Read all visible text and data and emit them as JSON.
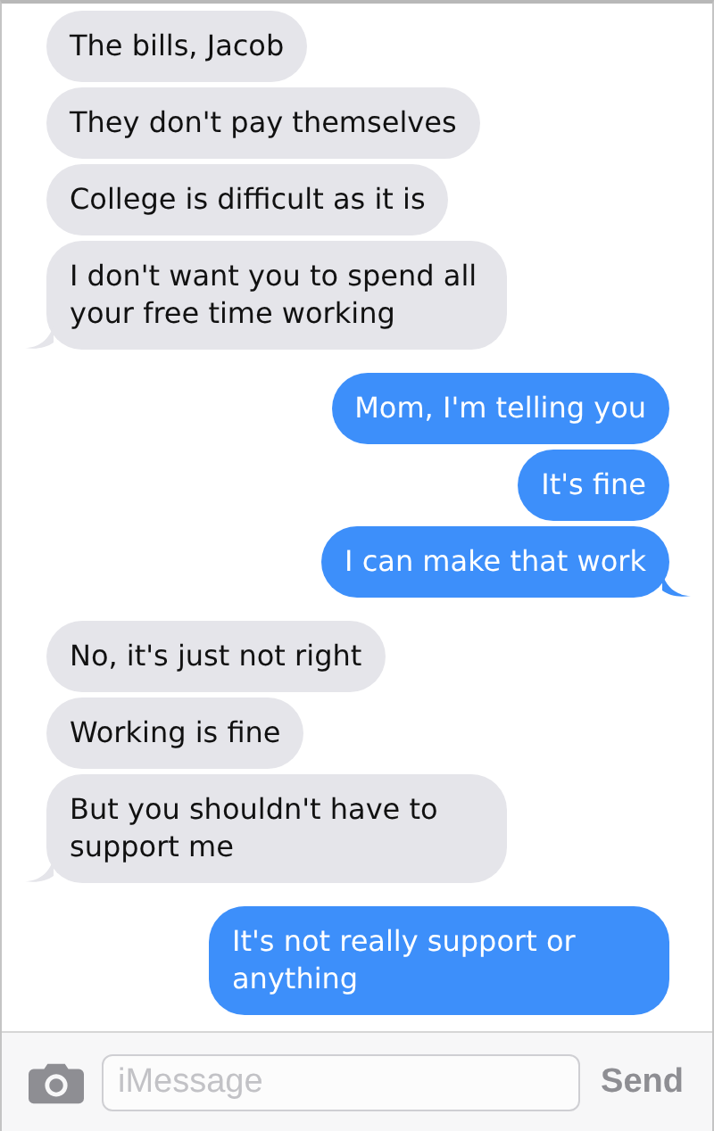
{
  "messages": [
    {
      "kind": "received",
      "text": "The bills, Jacob",
      "tail": false
    },
    {
      "kind": "received",
      "text": "They don't pay themselves",
      "tail": false
    },
    {
      "kind": "received",
      "text": "College is difficult as it is",
      "tail": false
    },
    {
      "kind": "received",
      "text": "I don't want you to spend all your free time working",
      "tail": true
    },
    {
      "kind": "sent",
      "text": "Mom, I'm telling you",
      "tail": false
    },
    {
      "kind": "sent",
      "text": "It's fine",
      "tail": false
    },
    {
      "kind": "sent",
      "text": "I can make that work",
      "tail": true
    },
    {
      "kind": "received",
      "text": "No, it's just not right",
      "tail": false
    },
    {
      "kind": "received",
      "text": "Working is fine",
      "tail": false
    },
    {
      "kind": "received",
      "text": "But you shouldn't have to support me",
      "tail": true
    },
    {
      "kind": "sent",
      "text": "It's not really support or anything",
      "tail": false
    }
  ],
  "composer": {
    "placeholder": "iMessage",
    "send_label": "Send",
    "send_disabled": true
  }
}
